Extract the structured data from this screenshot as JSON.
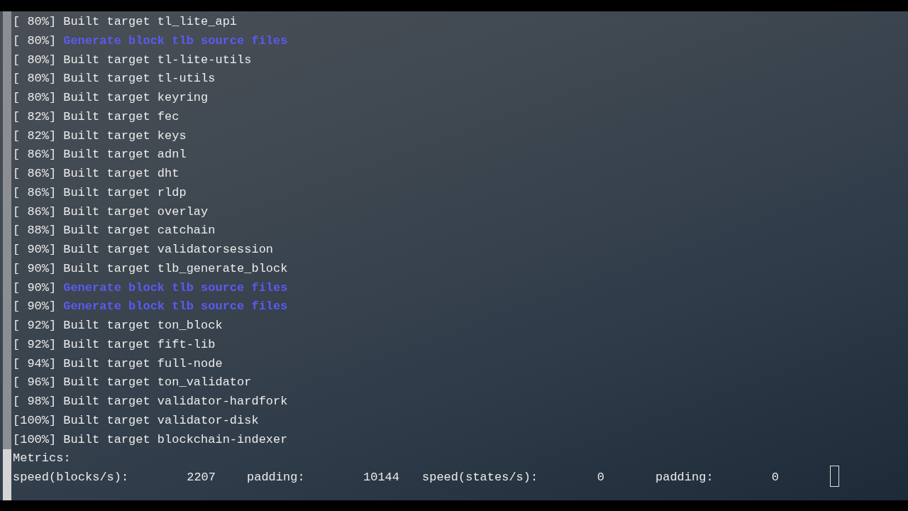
{
  "lines": [
    {
      "progress": "[ 80%]",
      "message": "Built target tl_lite_api",
      "kind": "built"
    },
    {
      "progress": "[ 80%]",
      "message": "Generate block tlb source files",
      "kind": "generate"
    },
    {
      "progress": "[ 80%]",
      "message": "Built target tl-lite-utils",
      "kind": "built"
    },
    {
      "progress": "[ 80%]",
      "message": "Built target tl-utils",
      "kind": "built"
    },
    {
      "progress": "[ 80%]",
      "message": "Built target keyring",
      "kind": "built"
    },
    {
      "progress": "[ 82%]",
      "message": "Built target fec",
      "kind": "built"
    },
    {
      "progress": "[ 82%]",
      "message": "Built target keys",
      "kind": "built"
    },
    {
      "progress": "[ 86%]",
      "message": "Built target adnl",
      "kind": "built"
    },
    {
      "progress": "[ 86%]",
      "message": "Built target dht",
      "kind": "built"
    },
    {
      "progress": "[ 86%]",
      "message": "Built target rldp",
      "kind": "built"
    },
    {
      "progress": "[ 86%]",
      "message": "Built target overlay",
      "kind": "built"
    },
    {
      "progress": "[ 88%]",
      "message": "Built target catchain",
      "kind": "built"
    },
    {
      "progress": "[ 90%]",
      "message": "Built target validatorsession",
      "kind": "built"
    },
    {
      "progress": "[ 90%]",
      "message": "Built target tlb_generate_block",
      "kind": "built"
    },
    {
      "progress": "[ 90%]",
      "message": "Generate block tlb source files",
      "kind": "generate"
    },
    {
      "progress": "[ 90%]",
      "message": "Generate block tlb source files",
      "kind": "generate"
    },
    {
      "progress": "[ 92%]",
      "message": "Built target ton_block",
      "kind": "built"
    },
    {
      "progress": "[ 92%]",
      "message": "Built target fift-lib",
      "kind": "built"
    },
    {
      "progress": "[ 94%]",
      "message": "Built target full-node",
      "kind": "built"
    },
    {
      "progress": "[ 96%]",
      "message": "Built target ton_validator",
      "kind": "built"
    },
    {
      "progress": "[ 98%]",
      "message": "Built target validator-hardfork",
      "kind": "built"
    },
    {
      "progress": "[100%]",
      "message": "Built target validator-disk",
      "kind": "built"
    },
    {
      "progress": "[100%]",
      "message": "Built target blockchain-indexer",
      "kind": "built"
    }
  ],
  "metrics_heading": "Metrics:",
  "metrics": [
    {
      "label": "speed(blocks/s):",
      "value": "2207"
    },
    {
      "label": "padding:",
      "value": "10144"
    },
    {
      "label": "speed(states/s):",
      "value": "0"
    },
    {
      "label": "padding:",
      "value": "0"
    }
  ]
}
